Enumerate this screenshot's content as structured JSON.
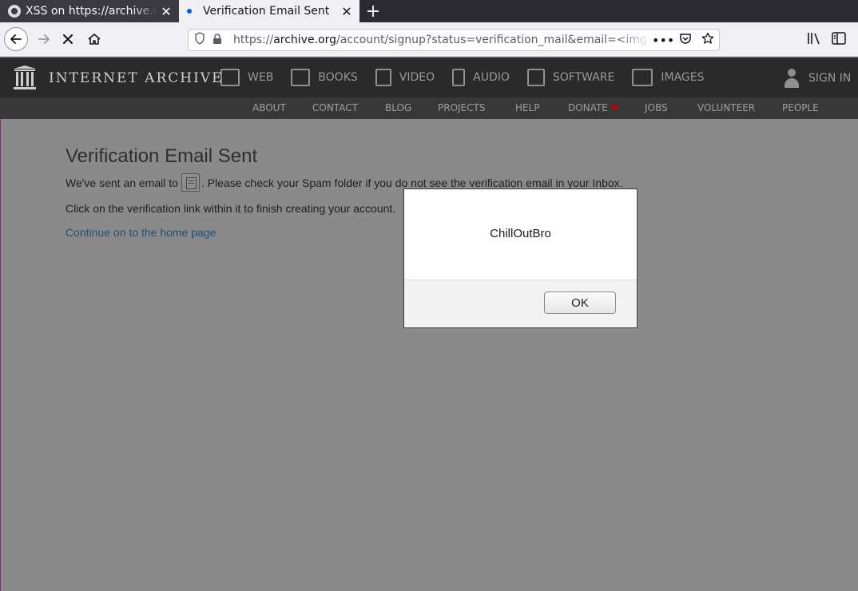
{
  "browser": {
    "tabs": [
      {
        "title": "XSS on https://archive.org",
        "active": false,
        "favicon": "github-icon"
      },
      {
        "title": "Verification Email Sent",
        "active": true,
        "favicon": "loading-dot-icon"
      }
    ],
    "new_tab_label": "+",
    "close_glyph": "✕",
    "url_prefix": "https://",
    "url_host": "archive.org",
    "url_path": "/account/signup?status=verification_mail&email=<img",
    "toolbar_icons": [
      "back-icon",
      "forward-icon",
      "stop-icon",
      "home-icon",
      "shield-icon",
      "lock-icon",
      "more-icon",
      "pocket-icon",
      "bookmark-star-icon",
      "library-icon",
      "sidebar-icon"
    ]
  },
  "site": {
    "wordmark": "INTERNET ARCHIVE",
    "nav": [
      {
        "label": "WEB",
        "icon": "web-icon"
      },
      {
        "label": "BOOKS",
        "icon": "books-icon"
      },
      {
        "label": "VIDEO",
        "icon": "video-icon"
      },
      {
        "label": "AUDIO",
        "icon": "audio-icon"
      },
      {
        "label": "SOFTWARE",
        "icon": "software-icon"
      },
      {
        "label": "IMAGES",
        "icon": "images-icon"
      }
    ],
    "signin": "SIGN IN",
    "subnav": [
      "ABOUT",
      "CONTACT",
      "BLOG",
      "PROJECTS",
      "HELP",
      "DONATE",
      "JOBS",
      "VOLUNTEER",
      "PEOPLE"
    ],
    "colors": {
      "header_bg": "#2a2a2a",
      "subnav_bg": "#383838",
      "donate_heart": "#c40000"
    }
  },
  "page": {
    "title": "Verification Email Sent",
    "para1_before": "We've sent an email to",
    "para1_after": ". Please check your Spam folder if you do not see the verification email in your Inbox.",
    "para2": "Click on the verification link within it to finish creating your account.",
    "home_link": "Continue on to the home page"
  },
  "alert": {
    "message": "ChillOutBro",
    "ok_label": "OK"
  }
}
